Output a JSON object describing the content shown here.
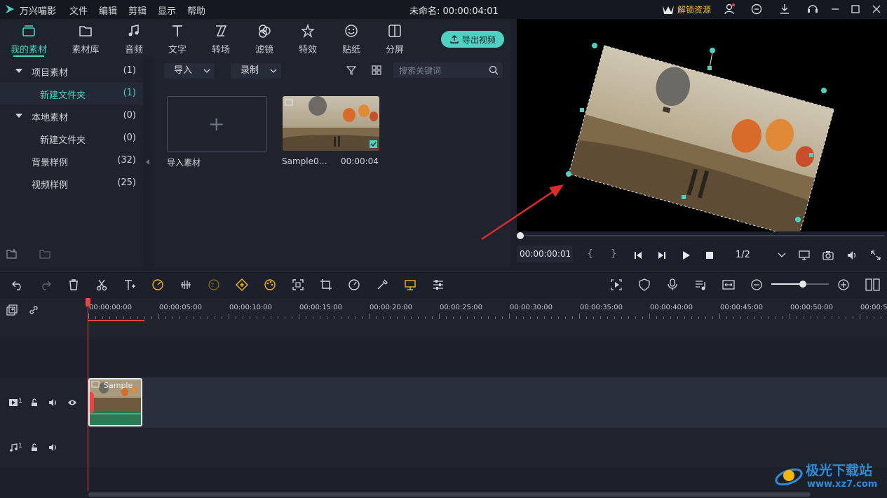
{
  "app": {
    "name": "万兴喵影",
    "menus": [
      "文件",
      "编辑",
      "剪辑",
      "显示",
      "帮助"
    ],
    "document_title": "未命名: 00:00:04:01",
    "unlock_label": "解锁资源"
  },
  "toolbar": {
    "tabs": [
      {
        "label": "我的素材",
        "icon": "folder-stack-icon",
        "active": true
      },
      {
        "label": "素材库",
        "icon": "folder-icon"
      },
      {
        "label": "音频",
        "icon": "music-note-icon"
      },
      {
        "label": "文字",
        "icon": "text-icon"
      },
      {
        "label": "转场",
        "icon": "transition-icon"
      },
      {
        "label": "滤镜",
        "icon": "filter-icon"
      },
      {
        "label": "特效",
        "icon": "effects-icon"
      },
      {
        "label": "贴纸",
        "icon": "sticker-icon"
      },
      {
        "label": "分屏",
        "icon": "split-screen-icon"
      }
    ],
    "export_label": "导出视频"
  },
  "tree": {
    "items": [
      {
        "name": "项目素材",
        "count": "(1)",
        "expanded": true
      },
      {
        "name": "新建文件夹",
        "count": "(1)",
        "selected": true
      },
      {
        "name": "本地素材",
        "count": "(0)",
        "expanded": true
      },
      {
        "name": "新建文件夹",
        "count": "(0)"
      },
      {
        "name": "背景样例",
        "count": "(32)"
      },
      {
        "name": "视频样例",
        "count": "(25)"
      }
    ]
  },
  "media": {
    "import_dropdown": "导入",
    "record_dropdown": "录制",
    "search_placeholder": "搜索关键词",
    "import_tile_label": "导入素材",
    "clip_name": "Sample0…",
    "clip_duration": "00:00:04"
  },
  "preview": {
    "timecode": "00:00:00:01",
    "quality": "1/2",
    "position_fraction": 0.0
  },
  "timeline": {
    "ruler_labels": [
      "00:00:00:00",
      "00:00:05:00",
      "00:00:10:00",
      "00:00:15:00",
      "00:00:20:00",
      "00:00:25:00",
      "00:00:30:00",
      "00:00:35:00",
      "00:00:40:00",
      "00:00:45:00",
      "00:00:50:00",
      "00:00:5"
    ],
    "video_track_label": "1",
    "audio_track_label": "1",
    "clip_title": "Sample",
    "zoom_fraction": 0.55
  },
  "watermark": {
    "text_cn": "极光下载站",
    "text_url": "www.xz7.com"
  },
  "colors": {
    "accent": "#4fd1c1",
    "playhead": "#ef4444",
    "unlock_gold": "#f0c44c"
  }
}
